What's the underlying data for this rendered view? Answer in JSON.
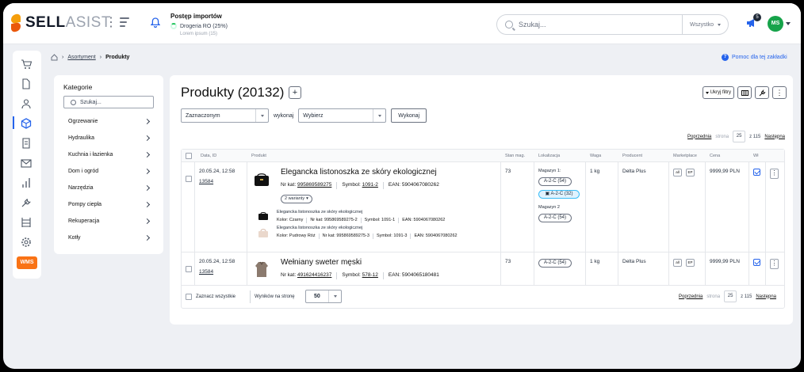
{
  "app": {
    "logo_part1": "SELL",
    "logo_part2": "ASIST"
  },
  "imports": {
    "title": "Postęp importów",
    "item1": "Drogeria RO (25%)",
    "item2": "Lorem ipsum (15)"
  },
  "search": {
    "placeholder": "Szukaj...",
    "scope": "Wszystko"
  },
  "notifications": {
    "count": "5"
  },
  "user": {
    "initials": "MS"
  },
  "breadcrumb": {
    "link": "Asortyment",
    "current": "Produkty"
  },
  "help": {
    "label": "Pomoc dla tej zakładki"
  },
  "categories": {
    "title": "Kategorie",
    "search_placeholder": "Szukaj...",
    "items": [
      "Ogrzewanie",
      "Hydraulika",
      "Kuchnia i łazienka",
      "Dom i ogród",
      "Narzędzia",
      "Pompy ciepła",
      "Rekuperacja",
      "Kotły"
    ]
  },
  "page": {
    "title": "Produkty (20132)",
    "plus": "+"
  },
  "toolbar": {
    "hide_filters": "Ukryj filtry"
  },
  "bulk": {
    "selection": "Zaznaczonym",
    "action_label": "wykonaj",
    "action": "Wybierz",
    "execute": "Wykonaj"
  },
  "pager": {
    "prev": "Poprzednia",
    "page_label": "strona",
    "page": "25",
    "of": "z 115",
    "next": "Następna"
  },
  "columns": [
    "Data, ID",
    "Produkt",
    "Stan mag.",
    "Lokalizacja",
    "Waga",
    "Producent",
    "Marketplace",
    "Cena",
    "Wł"
  ],
  "rows": [
    {
      "date": "20.05.24, 12:58",
      "id": "13584",
      "name": "Elegancka listonoszka ze skóry ekologicznej",
      "nr_kat_label": "Nr kat:",
      "nr_kat": "995869589275",
      "symbol_label": "Symbol:",
      "symbol": "1091-2",
      "ean_label": "EAN:",
      "ean": "5904067080262",
      "variants": "2 warianty",
      "variant_list": [
        {
          "name": "Elegancka listonoszka ze skóry ekologicznej",
          "color": "Kolor: Czarny",
          "nr_kat": "Nr kat: 995869589275-2",
          "symbol": "Symbol: 1091-1",
          "ean": "EAN: 5904067080262"
        },
        {
          "name": "Elegancka listonoszka ze skóry ekologicznej",
          "color": "Kolor: Pudrowy Róż",
          "nr_kat": "Nr kat: 995869589275-3",
          "symbol": "Symbol: 1091-3",
          "ean": "EAN: 5904067080262"
        }
      ],
      "stock": "73",
      "loc1_title": "Magazyn 1:",
      "loc1a": "A-2-C (54)",
      "loc1b": "A-2-C (32)",
      "loc2_title": "Magazyn 2",
      "loc2a": "A-2-C (54)",
      "weight": "1 kg",
      "producer": "Delta Plus",
      "mp1": "all",
      "mp2": "EP",
      "price": "9999,99 PLN"
    },
    {
      "date": "20.05.24, 12:58",
      "id": "13584",
      "name": "Wełniany sweter męski",
      "nr_kat_label": "Nr kat:",
      "nr_kat": "491624416237",
      "symbol_label": "Symbol:",
      "symbol": "578-12",
      "ean_label": "EAN:",
      "ean": "5904065180481",
      "stock": "73",
      "loc1a": "A-2-C (54)",
      "weight": "1 kg",
      "producer": "Delta Plus",
      "mp1": "all",
      "mp2": "EP",
      "price": "9999,99 PLN"
    }
  ],
  "footer": {
    "select_all": "Zaznacz wszystkie",
    "per_page_label": "Wyników na stronę",
    "per_page": "50"
  },
  "colors": {
    "accent": "#2563eb",
    "brand_orange": "#f97316",
    "avatar": "#16a34a"
  }
}
